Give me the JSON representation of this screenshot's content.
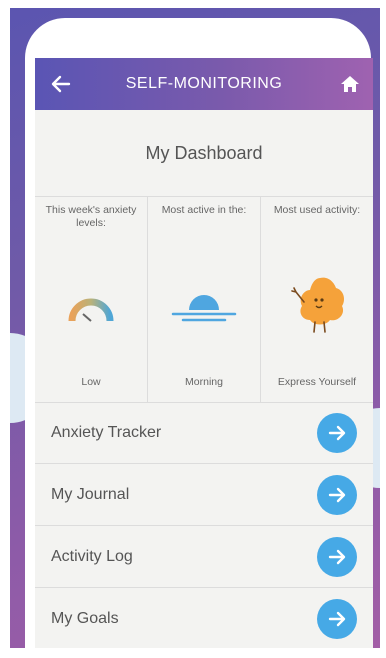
{
  "header": {
    "title": "SELF-MONITORING",
    "back_icon": "back-arrow-icon",
    "home_icon": "home-icon"
  },
  "dashboard": {
    "title": "My Dashboard",
    "stats": [
      {
        "label": "This week's anxiety levels:",
        "value": "Low",
        "icon": "gauge-icon"
      },
      {
        "label": "Most active in the:",
        "value": "Morning",
        "icon": "sunrise-icon"
      },
      {
        "label": "Most used activity:",
        "value": "Express Yourself",
        "icon": "mascot-icon"
      }
    ]
  },
  "menu": [
    {
      "label": "Anxiety Tracker"
    },
    {
      "label": "My Journal"
    },
    {
      "label": "Activity Log"
    },
    {
      "label": "My Goals"
    }
  ],
  "colors": {
    "header_start": "#5a55b4",
    "header_end": "#9f62b0",
    "arrow_button": "#46a9e6",
    "mascot": "#f5a23a"
  }
}
